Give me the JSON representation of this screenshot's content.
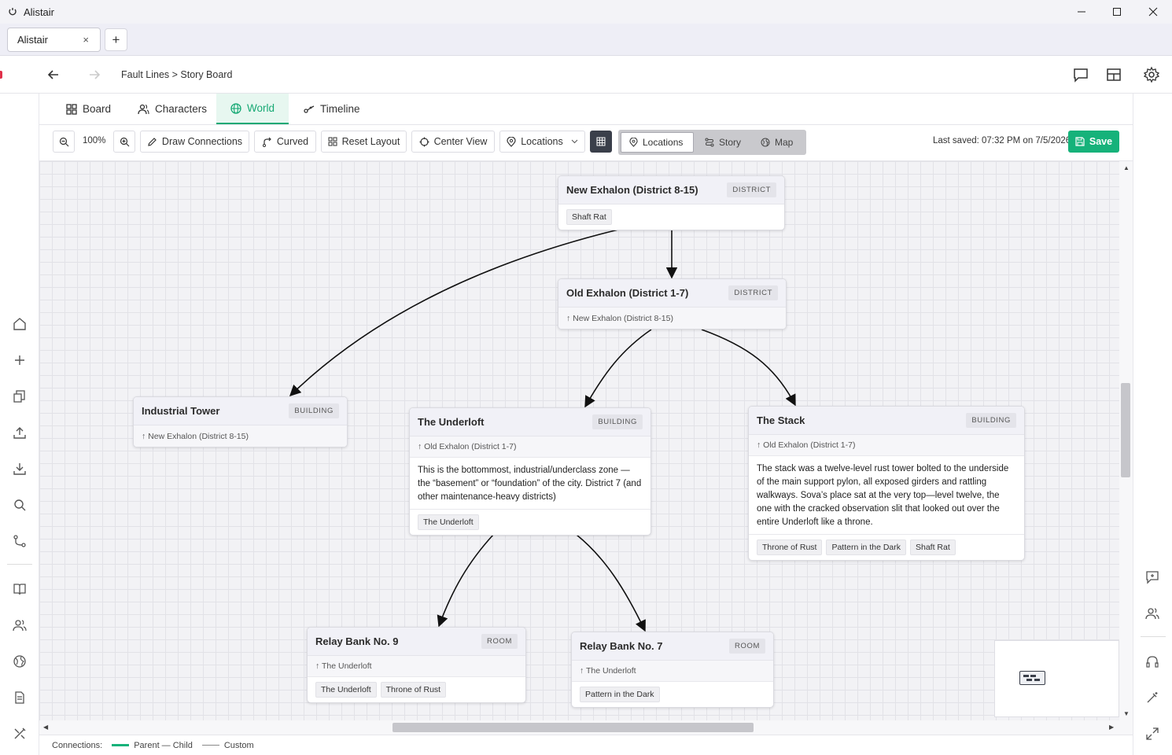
{
  "window": {
    "title": "Alistair",
    "tab_label": "Alistair"
  },
  "breadcrumb": "Fault Lines > Story Board",
  "view_tabs": [
    {
      "label": "Board"
    },
    {
      "label": "Characters"
    },
    {
      "label": "World"
    },
    {
      "label": "Timeline"
    }
  ],
  "toolbar": {
    "zoom": "100%",
    "draw_connections": "Draw Connections",
    "curved": "Curved",
    "reset_layout": "Reset Layout",
    "center_view": "Center View",
    "filter_select": "Locations",
    "segments": [
      "Locations",
      "Story",
      "Map"
    ],
    "last_saved": "Last saved: 07:32 PM on 7/5/2026",
    "save": "Save"
  },
  "nodes": {
    "new_exhalon": {
      "title": "New Exhalon (District 8-15)",
      "badge": "DISTRICT",
      "tags": [
        "Shaft Rat"
      ]
    },
    "old_exhalon": {
      "title": "Old Exhalon (District 1-7)",
      "badge": "DISTRICT",
      "parent": "↑ New Exhalon (District 8-15)"
    },
    "industrial_tower": {
      "title": "Industrial Tower",
      "badge": "BUILDING",
      "parent": "↑ New Exhalon (District 8-15)"
    },
    "underloft": {
      "title": "The Underloft",
      "badge": "BUILDING",
      "parent": "↑ Old Exhalon (District 1-7)",
      "description": "This is the bottommost, industrial/underclass zone — the “basement” or “foundation” of the city. District 7 (and other maintenance-heavy districts)",
      "tags": [
        "The Underloft"
      ]
    },
    "stack": {
      "title": "The Stack",
      "badge": "BUILDING",
      "parent": "↑ Old Exhalon (District 1-7)",
      "description": "The stack was a twelve-level rust tower bolted to the underside of the main support pylon, all exposed girders and rattling walkways. Sova’s place sat at the very top—level twelve, the one with the cracked observation slit that looked out over the entire Underloft like a throne.",
      "tags": [
        "Throne of Rust",
        "Pattern in the Dark",
        "Shaft Rat"
      ]
    },
    "relay9": {
      "title": "Relay Bank No. 9",
      "badge": "ROOM",
      "parent": "↑ The Underloft",
      "tags": [
        "The Underloft",
        "Throne of Rust"
      ]
    },
    "relay7": {
      "title": "Relay Bank No. 7",
      "badge": "ROOM",
      "parent": "↑ The Underloft",
      "tags": [
        "Pattern in the Dark"
      ]
    }
  },
  "legend": {
    "label": "Connections:",
    "parent_child": "Parent — Child",
    "custom": "Custom"
  },
  "colors": {
    "accent": "#16b27a",
    "dark": "#3a3f4a"
  }
}
